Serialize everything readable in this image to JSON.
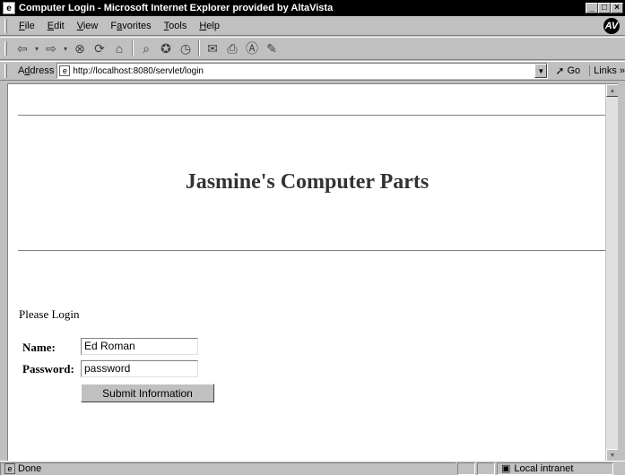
{
  "window": {
    "title": "Computer Login - Microsoft Internet Explorer provided by AltaVista",
    "minimize": "_",
    "maximize": "□",
    "close": "×"
  },
  "menu": {
    "items": [
      {
        "label": "File",
        "key": "F",
        "rest": "ile"
      },
      {
        "label": "Edit",
        "key": "E",
        "rest": "dit"
      },
      {
        "label": "View",
        "key": "V",
        "rest": "iew"
      },
      {
        "label": "Favorites",
        "pre": "F",
        "key": "a",
        "rest": "vorites"
      },
      {
        "label": "Tools",
        "key": "T",
        "rest": "ools"
      },
      {
        "label": "Help",
        "key": "H",
        "rest": "elp"
      }
    ],
    "logo": "AV"
  },
  "toolbar": {
    "icons": [
      "back-icon",
      "forward-icon",
      "stop-icon",
      "refresh-icon",
      "home-icon",
      "search-icon",
      "favorites-icon",
      "history-icon",
      "mail-icon",
      "print-icon",
      "altavista-icon",
      "edit-icon"
    ]
  },
  "address": {
    "label_pre": "A",
    "label_key": "d",
    "label_rest": "dress",
    "url": "http://localhost:8080/servlet/login",
    "go": "Go",
    "links": "Links »"
  },
  "page": {
    "heading": "Jasmine's Computer Parts",
    "prompt": "Please Login",
    "name_label": "Name:",
    "name_value": "Ed Roman",
    "password_label": "Password:",
    "password_value": "password",
    "submit_label": "Submit Information"
  },
  "status": {
    "text": "Done",
    "zone": "Local intranet"
  }
}
